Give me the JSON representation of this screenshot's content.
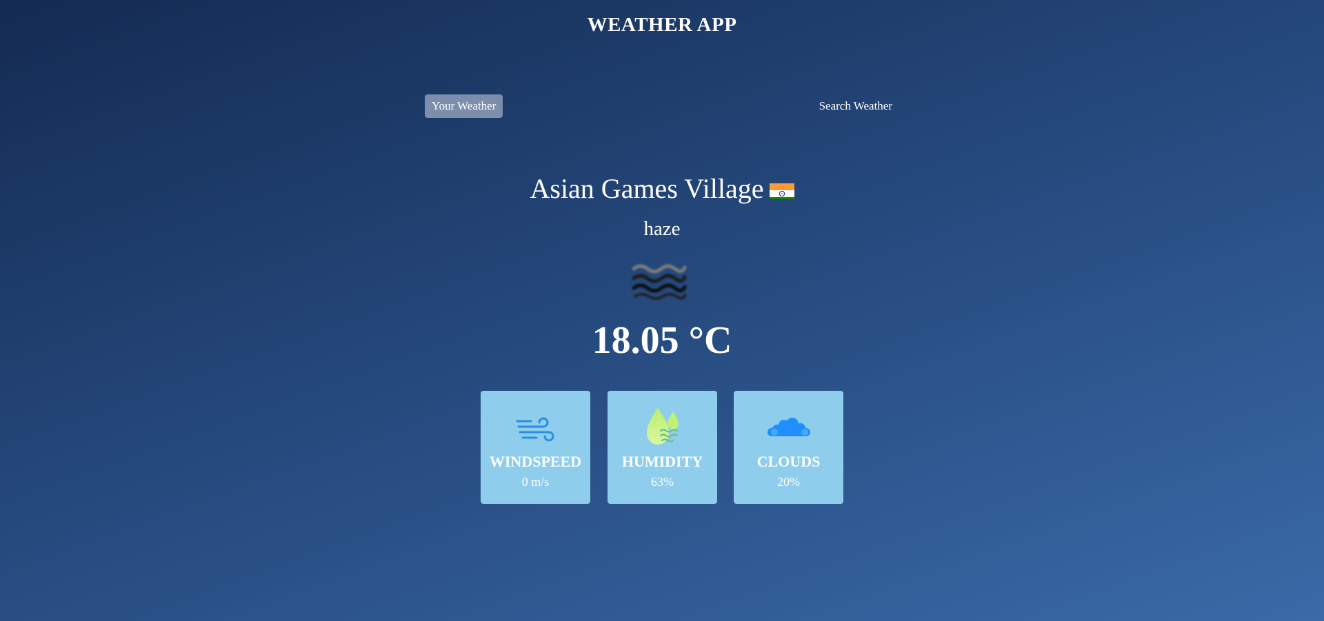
{
  "app": {
    "title": "WEATHER APP"
  },
  "tabs": {
    "your_weather": "Your Weather",
    "search_weather": "Search Weather",
    "active": "your_weather"
  },
  "weather": {
    "location": "Asian Games Village",
    "country_flag_icon": "india-flag-icon",
    "description": "haze",
    "condition_icon": "haze-icon",
    "temperature": "18.05 °C"
  },
  "stats": {
    "windspeed": {
      "label": "WINDSPEED",
      "value": "0 m/s",
      "icon": "wind-icon"
    },
    "humidity": {
      "label": "HUMIDITY",
      "value": "63%",
      "icon": "humidity-drop-icon"
    },
    "clouds": {
      "label": "CLOUDS",
      "value": "20%",
      "icon": "cloud-icon"
    }
  },
  "colors": {
    "background_top": "#142b52",
    "background_bottom": "#3a6aa8",
    "card_background": "#8ecdec",
    "active_tab": "#dbe2ef",
    "text": "#ffffff"
  }
}
